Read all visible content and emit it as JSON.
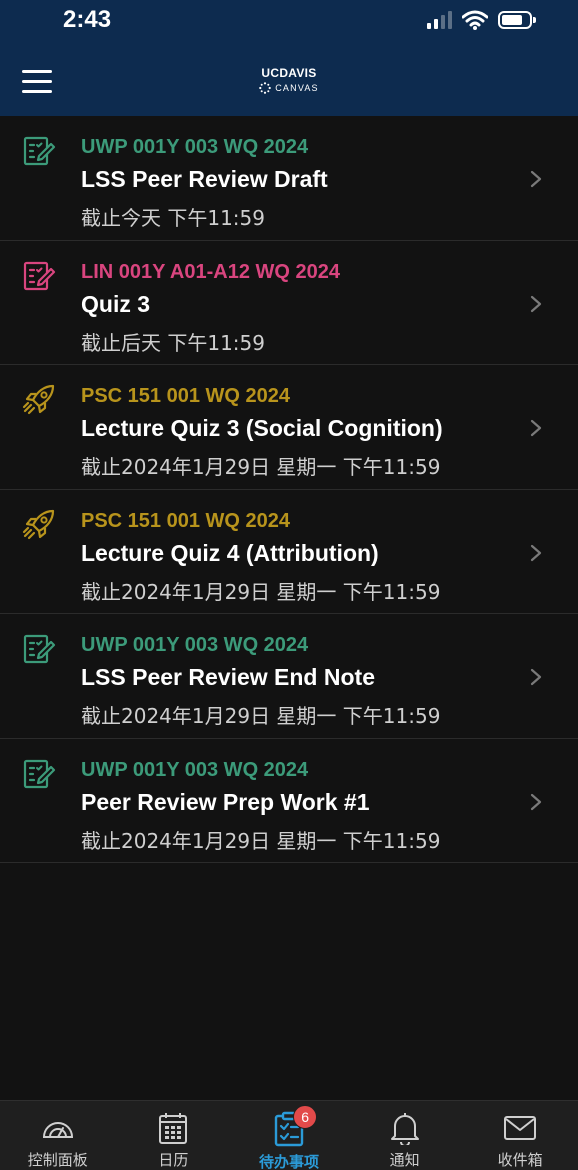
{
  "status_bar": {
    "time": "2:43"
  },
  "header": {
    "logo_top_bold": "UC",
    "logo_top": "DAVIS",
    "logo_bottom": "CANVAS"
  },
  "colors": {
    "header_bg": "#0d2b4f",
    "background": "#121212",
    "uwp_green": "#3c9b7a",
    "lin_pink": "#d9457f",
    "psc_gold": "#b8941c",
    "active_tab": "#2b9bd8",
    "badge_red": "#e24a4a"
  },
  "todo_items": [
    {
      "icon": "assignment-icon",
      "course": "UWP 001Y 003 WQ 2024",
      "course_color": "#3c9b7a",
      "title": "LSS Peer Review Draft",
      "due": "截止今天 下午11:59"
    },
    {
      "icon": "assignment-icon",
      "course": "LIN 001Y A01-A12 WQ 2024",
      "course_color": "#d9457f",
      "title": "Quiz 3",
      "due": "截止后天 下午11:59"
    },
    {
      "icon": "quiz-rocket-icon",
      "course": "PSC 151 001 WQ 2024",
      "course_color": "#b8941c",
      "title": "Lecture Quiz 3 (Social Cognition)",
      "due": "截止2024年1月29日 星期一 下午11:59"
    },
    {
      "icon": "quiz-rocket-icon",
      "course": "PSC 151 001 WQ 2024",
      "course_color": "#b8941c",
      "title": "Lecture Quiz 4 (Attribution)",
      "due": "截止2024年1月29日 星期一 下午11:59"
    },
    {
      "icon": "assignment-icon",
      "course": "UWP 001Y 003 WQ 2024",
      "course_color": "#3c9b7a",
      "title": "LSS Peer Review End Note",
      "due": "截止2024年1月29日 星期一 下午11:59"
    },
    {
      "icon": "assignment-icon",
      "course": "UWP 001Y 003 WQ 2024",
      "course_color": "#3c9b7a",
      "title": "Peer Review Prep Work #1",
      "due": "截止2024年1月29日 星期一 下午11:59"
    }
  ],
  "tabs": [
    {
      "label": "控制面板",
      "icon": "dashboard-icon",
      "active": false
    },
    {
      "label": "日历",
      "icon": "calendar-icon",
      "active": false
    },
    {
      "label": "待办事项",
      "icon": "todo-clipboard-icon",
      "active": true,
      "badge": "6"
    },
    {
      "label": "通知",
      "icon": "bell-icon",
      "active": false
    },
    {
      "label": "收件箱",
      "icon": "mail-icon",
      "active": false
    }
  ]
}
